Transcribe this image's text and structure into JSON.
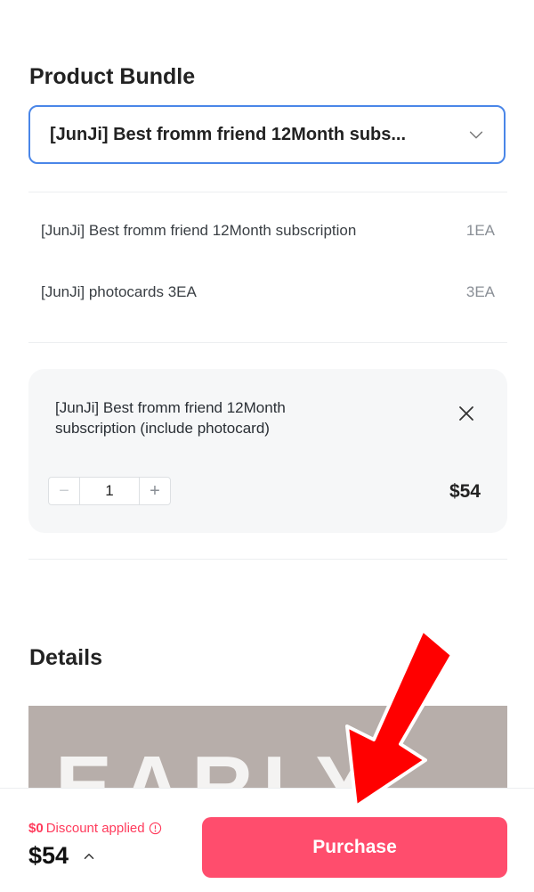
{
  "product_bundle": {
    "title": "Product Bundle",
    "selected_option": "[JunJi] Best fromm friend 12Month subs...",
    "items": [
      {
        "name": "[JunJi] Best fromm friend 12Month subscription",
        "qty": "1EA"
      },
      {
        "name": "[JunJi] photocards 3EA",
        "qty": "3EA"
      }
    ]
  },
  "cart_item": {
    "title": "[JunJi] Best fromm friend 12Month subscription (include photocard)",
    "quantity": "1",
    "price": "$54",
    "icons": {
      "close": "close-icon",
      "minus": "minus-icon",
      "plus": "plus-icon"
    }
  },
  "details": {
    "title": "Details",
    "banner_text": "EARLY"
  },
  "footer": {
    "discount_amount": "$0",
    "discount_label": "Discount applied",
    "total": "$54",
    "purchase_label": "Purchase"
  },
  "colors": {
    "accent": "#ff4d6d",
    "select_border": "#4a86e8",
    "discount_text": "#ff3b5c",
    "annotation_arrow": "#ff0000"
  }
}
